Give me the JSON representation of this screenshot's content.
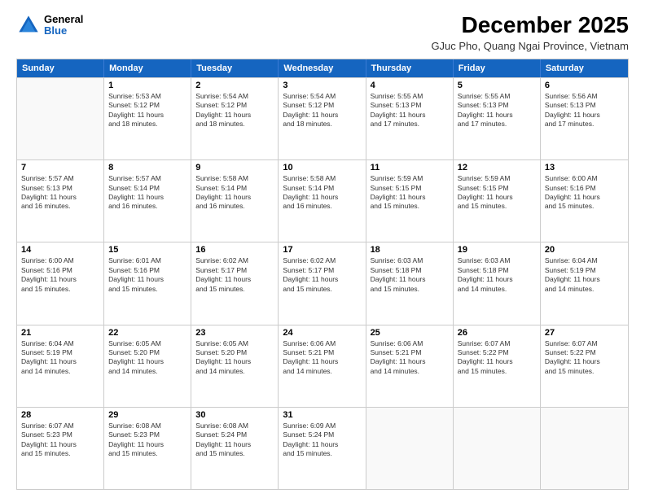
{
  "header": {
    "logo_line1": "General",
    "logo_line2": "Blue",
    "main_title": "December 2025",
    "sub_title": "GJuc Pho, Quang Ngai Province, Vietnam"
  },
  "calendar": {
    "days_of_week": [
      "Sunday",
      "Monday",
      "Tuesday",
      "Wednesday",
      "Thursday",
      "Friday",
      "Saturday"
    ],
    "rows": [
      [
        {
          "day": "",
          "info": ""
        },
        {
          "day": "1",
          "info": "Sunrise: 5:53 AM\nSunset: 5:12 PM\nDaylight: 11 hours\nand 18 minutes."
        },
        {
          "day": "2",
          "info": "Sunrise: 5:54 AM\nSunset: 5:12 PM\nDaylight: 11 hours\nand 18 minutes."
        },
        {
          "day": "3",
          "info": "Sunrise: 5:54 AM\nSunset: 5:12 PM\nDaylight: 11 hours\nand 18 minutes."
        },
        {
          "day": "4",
          "info": "Sunrise: 5:55 AM\nSunset: 5:13 PM\nDaylight: 11 hours\nand 17 minutes."
        },
        {
          "day": "5",
          "info": "Sunrise: 5:55 AM\nSunset: 5:13 PM\nDaylight: 11 hours\nand 17 minutes."
        },
        {
          "day": "6",
          "info": "Sunrise: 5:56 AM\nSunset: 5:13 PM\nDaylight: 11 hours\nand 17 minutes."
        }
      ],
      [
        {
          "day": "7",
          "info": "Sunrise: 5:57 AM\nSunset: 5:13 PM\nDaylight: 11 hours\nand 16 minutes."
        },
        {
          "day": "8",
          "info": "Sunrise: 5:57 AM\nSunset: 5:14 PM\nDaylight: 11 hours\nand 16 minutes."
        },
        {
          "day": "9",
          "info": "Sunrise: 5:58 AM\nSunset: 5:14 PM\nDaylight: 11 hours\nand 16 minutes."
        },
        {
          "day": "10",
          "info": "Sunrise: 5:58 AM\nSunset: 5:14 PM\nDaylight: 11 hours\nand 16 minutes."
        },
        {
          "day": "11",
          "info": "Sunrise: 5:59 AM\nSunset: 5:15 PM\nDaylight: 11 hours\nand 15 minutes."
        },
        {
          "day": "12",
          "info": "Sunrise: 5:59 AM\nSunset: 5:15 PM\nDaylight: 11 hours\nand 15 minutes."
        },
        {
          "day": "13",
          "info": "Sunrise: 6:00 AM\nSunset: 5:16 PM\nDaylight: 11 hours\nand 15 minutes."
        }
      ],
      [
        {
          "day": "14",
          "info": "Sunrise: 6:00 AM\nSunset: 5:16 PM\nDaylight: 11 hours\nand 15 minutes."
        },
        {
          "day": "15",
          "info": "Sunrise: 6:01 AM\nSunset: 5:16 PM\nDaylight: 11 hours\nand 15 minutes."
        },
        {
          "day": "16",
          "info": "Sunrise: 6:02 AM\nSunset: 5:17 PM\nDaylight: 11 hours\nand 15 minutes."
        },
        {
          "day": "17",
          "info": "Sunrise: 6:02 AM\nSunset: 5:17 PM\nDaylight: 11 hours\nand 15 minutes."
        },
        {
          "day": "18",
          "info": "Sunrise: 6:03 AM\nSunset: 5:18 PM\nDaylight: 11 hours\nand 15 minutes."
        },
        {
          "day": "19",
          "info": "Sunrise: 6:03 AM\nSunset: 5:18 PM\nDaylight: 11 hours\nand 14 minutes."
        },
        {
          "day": "20",
          "info": "Sunrise: 6:04 AM\nSunset: 5:19 PM\nDaylight: 11 hours\nand 14 minutes."
        }
      ],
      [
        {
          "day": "21",
          "info": "Sunrise: 6:04 AM\nSunset: 5:19 PM\nDaylight: 11 hours\nand 14 minutes."
        },
        {
          "day": "22",
          "info": "Sunrise: 6:05 AM\nSunset: 5:20 PM\nDaylight: 11 hours\nand 14 minutes."
        },
        {
          "day": "23",
          "info": "Sunrise: 6:05 AM\nSunset: 5:20 PM\nDaylight: 11 hours\nand 14 minutes."
        },
        {
          "day": "24",
          "info": "Sunrise: 6:06 AM\nSunset: 5:21 PM\nDaylight: 11 hours\nand 14 minutes."
        },
        {
          "day": "25",
          "info": "Sunrise: 6:06 AM\nSunset: 5:21 PM\nDaylight: 11 hours\nand 14 minutes."
        },
        {
          "day": "26",
          "info": "Sunrise: 6:07 AM\nSunset: 5:22 PM\nDaylight: 11 hours\nand 15 minutes."
        },
        {
          "day": "27",
          "info": "Sunrise: 6:07 AM\nSunset: 5:22 PM\nDaylight: 11 hours\nand 15 minutes."
        }
      ],
      [
        {
          "day": "28",
          "info": "Sunrise: 6:07 AM\nSunset: 5:23 PM\nDaylight: 11 hours\nand 15 minutes."
        },
        {
          "day": "29",
          "info": "Sunrise: 6:08 AM\nSunset: 5:23 PM\nDaylight: 11 hours\nand 15 minutes."
        },
        {
          "day": "30",
          "info": "Sunrise: 6:08 AM\nSunset: 5:24 PM\nDaylight: 11 hours\nand 15 minutes."
        },
        {
          "day": "31",
          "info": "Sunrise: 6:09 AM\nSunset: 5:24 PM\nDaylight: 11 hours\nand 15 minutes."
        },
        {
          "day": "",
          "info": ""
        },
        {
          "day": "",
          "info": ""
        },
        {
          "day": "",
          "info": ""
        }
      ]
    ]
  }
}
